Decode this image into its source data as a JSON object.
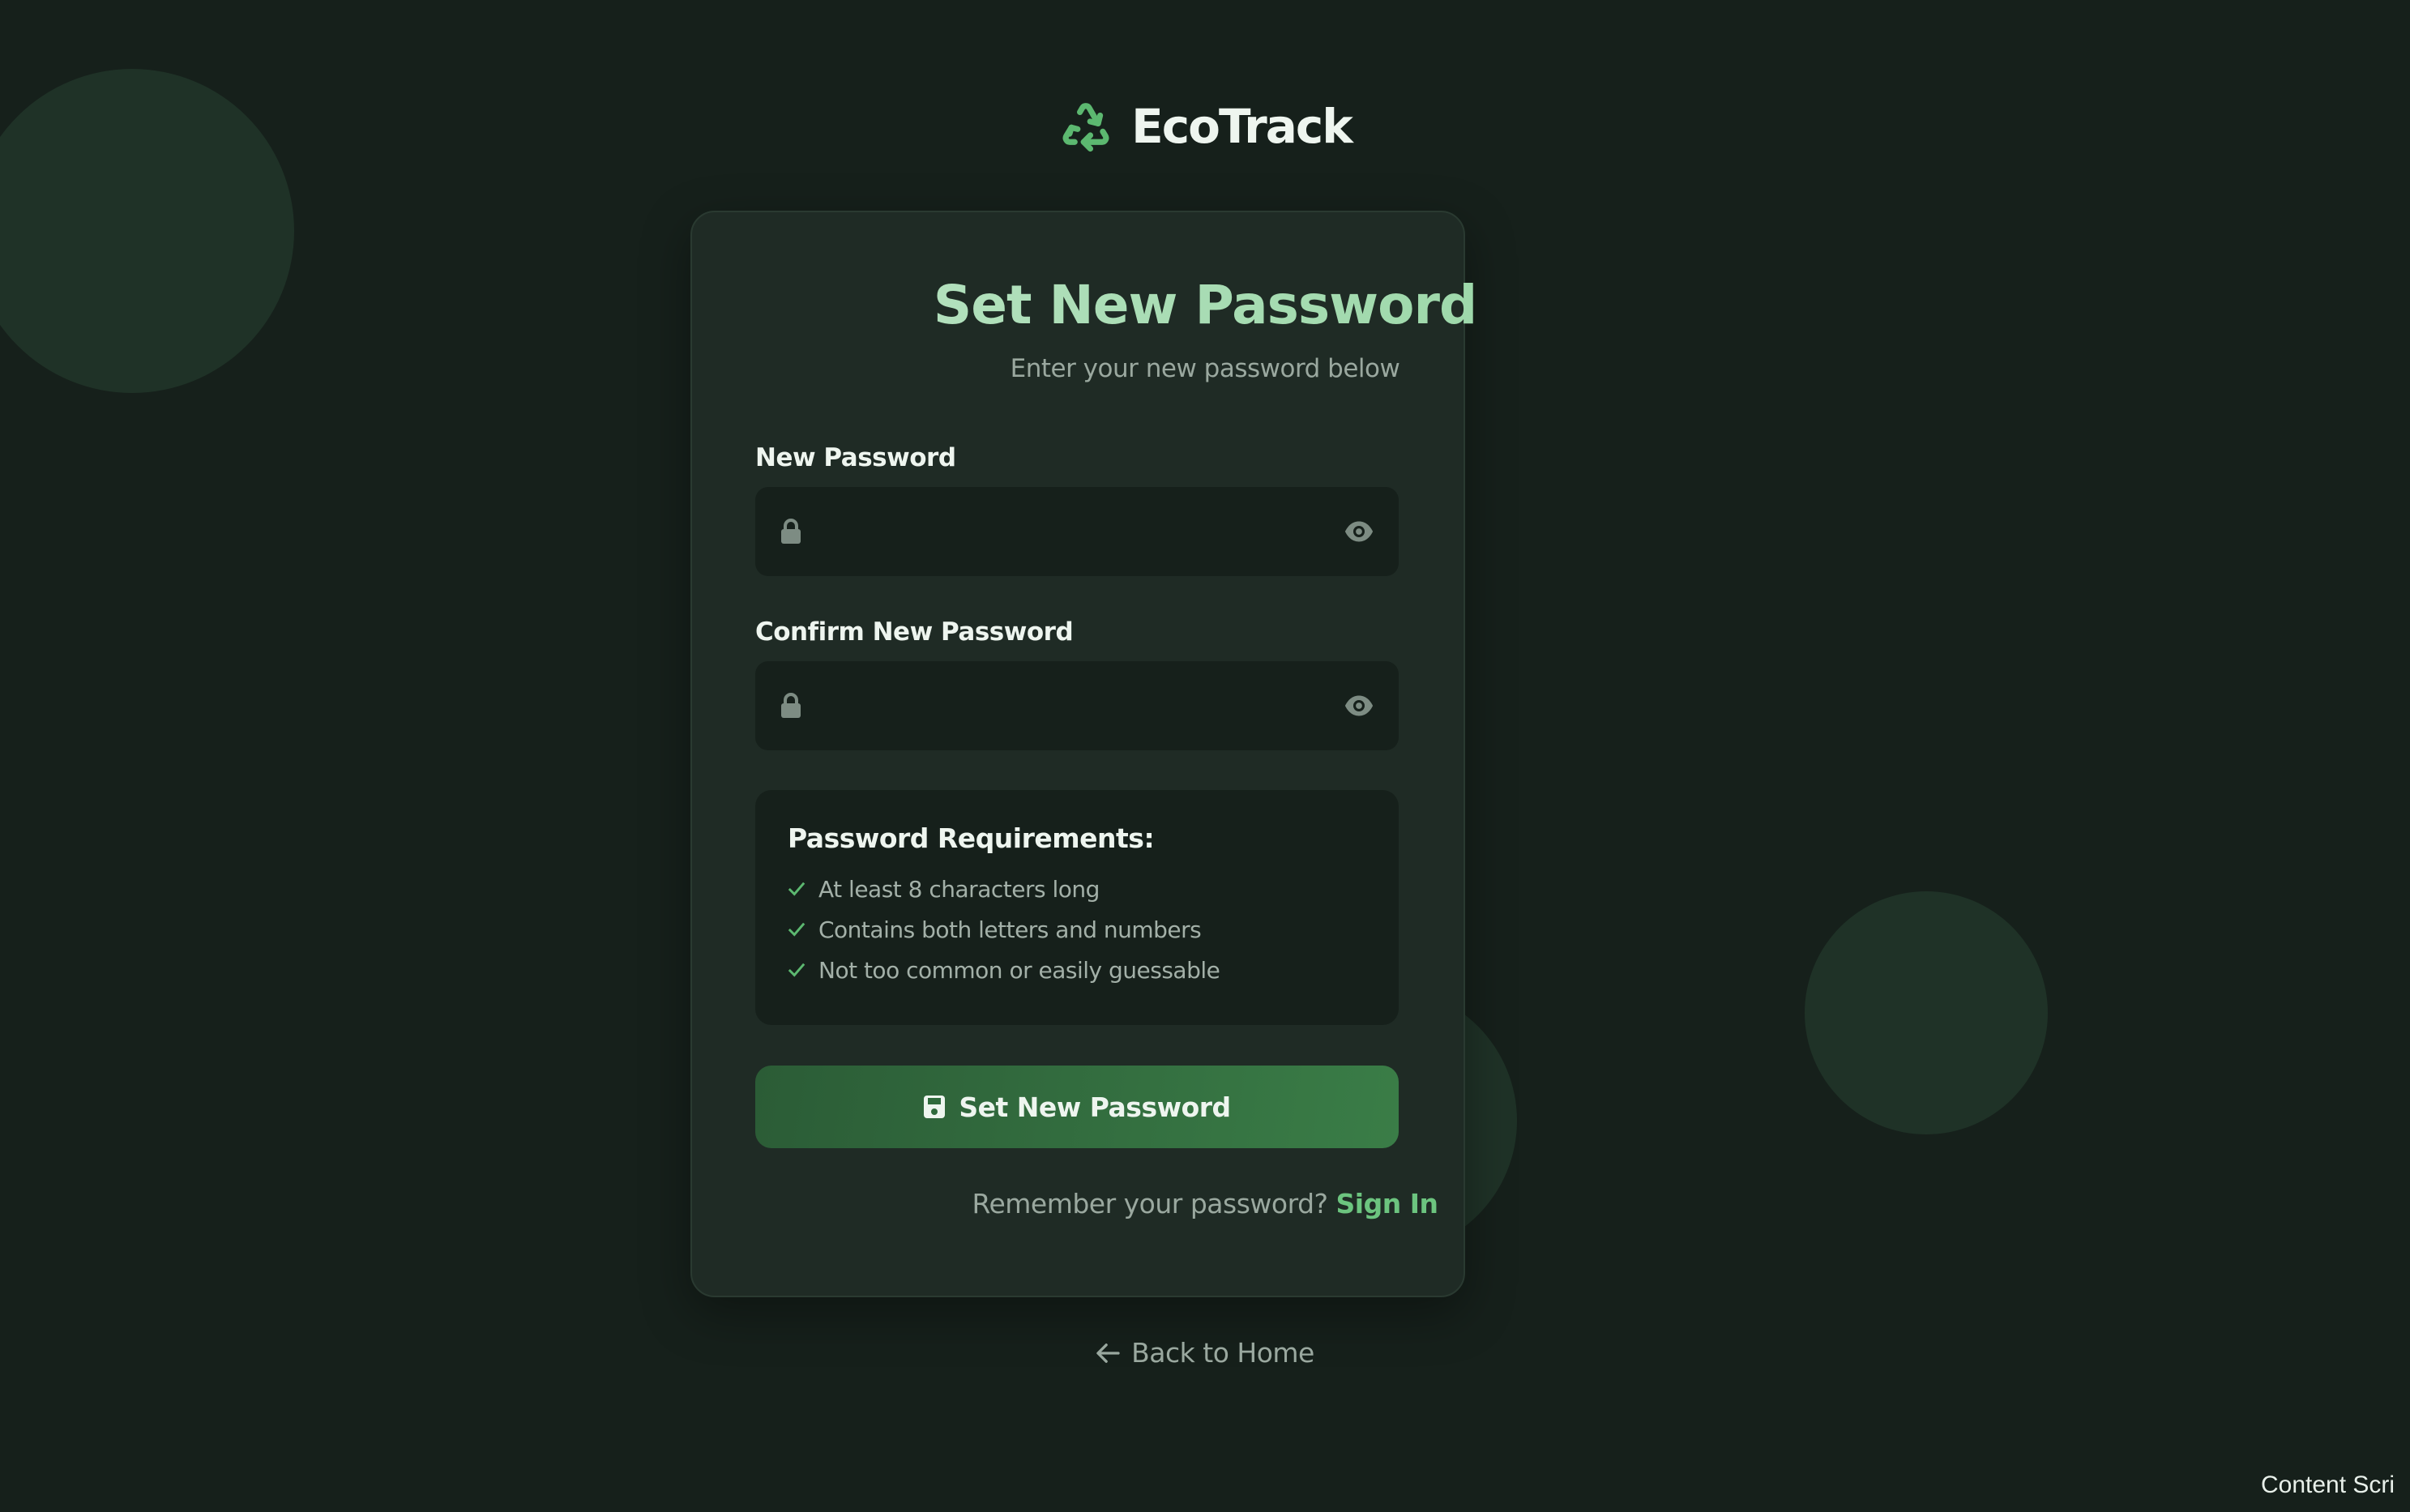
{
  "brand": {
    "name": "EcoTrack",
    "icon": "recycle-icon",
    "accent": "#5cb870"
  },
  "card": {
    "title": "Set New Password",
    "subtitle": "Enter your new password below",
    "fields": [
      {
        "label": "New Password",
        "value": "",
        "icon": "lock-icon",
        "toggle_icon": "eye-icon"
      },
      {
        "label": "Confirm New Password",
        "value": "",
        "icon": "lock-icon",
        "toggle_icon": "eye-icon"
      }
    ],
    "requirements": {
      "title": "Password Requirements:",
      "items": [
        "At least 8 characters long",
        "Contains both letters and numbers",
        "Not too common or easily guessable"
      ]
    },
    "submit_label": "Set New Password",
    "signin_prompt": "Remember your password?",
    "signin_link": "Sign In"
  },
  "back_link": "Back to Home",
  "overlay_text": "Content Scri"
}
